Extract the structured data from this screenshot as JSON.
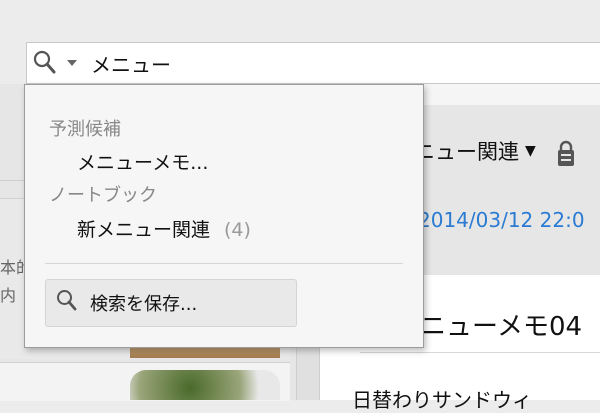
{
  "search": {
    "query": "メニュー"
  },
  "dropdown": {
    "suggestions_heading": "予測候補",
    "suggestion_item": "メニューメモ...",
    "notebooks_heading": "ノートブック",
    "notebook_item": "新メニュー関連",
    "notebook_count": "(4)",
    "save_search_label": "検索を保存..."
  },
  "left_list": {
    "snippet_line_1": "本的",
    "snippet_line_2": "内"
  },
  "note": {
    "notebook_name": "ニュー関連",
    "date": "2014/03/12 22:0",
    "title": "ニューメモ04",
    "body_first_line": "日替わりサンドウィ"
  },
  "colors": {
    "date_link": "#2a7bd1",
    "muted": "#888888"
  }
}
